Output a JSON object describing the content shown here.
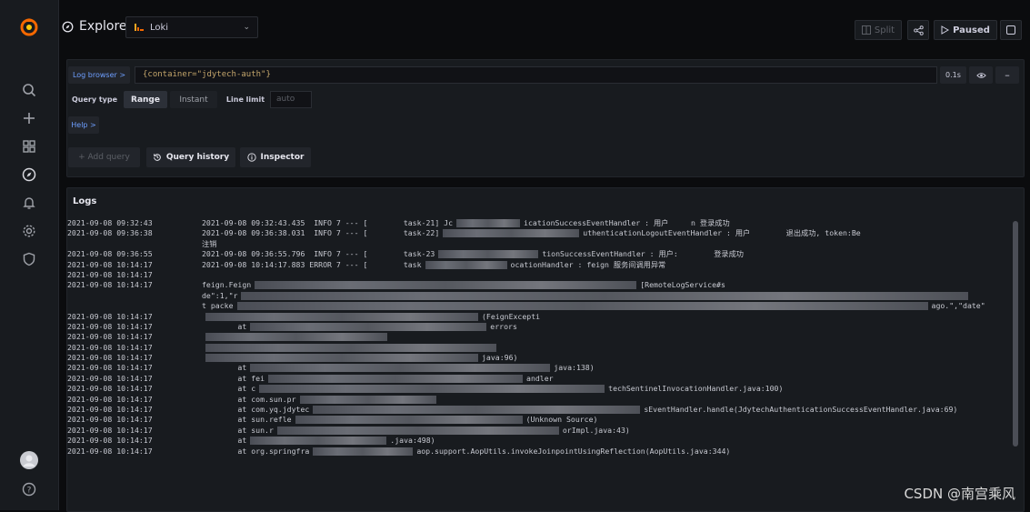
{
  "header": {
    "title": "Explore",
    "datasource": "Loki",
    "split_label": "Split",
    "paused_label": "Paused"
  },
  "query": {
    "log_browser_label": "Log browser >",
    "expression": "{container=\"jdytech-auth\"}",
    "duration_badge": "0.1s",
    "query_type_label": "Query type",
    "range_label": "Range",
    "instant_label": "Instant",
    "line_limit_label": "Line limit",
    "line_limit_placeholder": "auto",
    "help_label": "Help >",
    "add_query_label": "+ Add query",
    "query_history_label": "Query history",
    "inspector_label": "Inspector"
  },
  "logs": {
    "title": "Logs",
    "lines": [
      {
        "ts": "2021-09-08 09:32:43",
        "text": "2021-09-08 09:32:43.435  INFO 7 --- [        task-21] Jc",
        "tail": "icationSuccessEventHandler : 用户     n 登录成功"
      },
      {
        "ts": "2021-09-08 09:36:38",
        "text": "2021-09-08 09:36:38.031  INFO 7 --- [        task-22]",
        "tail": "uthenticationLogoutEventHandler : 用户        退出成功, token:Be"
      },
      {
        "ts": "",
        "text": "注销",
        "tail": ""
      },
      {
        "ts": "2021-09-08 09:36:55",
        "text": "2021-09-08 09:36:55.796  INFO 7 --- [        task-23",
        "tail": "tionSuccessEventHandler : 用户:        登录成功"
      },
      {
        "ts": "2021-09-08 10:14:17",
        "text": "2021-09-08 10:14:17.883 ERROR 7 --- [        task",
        "tail": "ocationHandler : feign 服务间调用异常"
      },
      {
        "ts": "2021-09-08 10:14:17",
        "text": "",
        "tail": ""
      },
      {
        "ts": "2021-09-08 10:14:17",
        "text": "feign.Feign",
        "tail": "[RemoteLogService#s"
      },
      {
        "ts": "",
        "text": "de\":1,\"r",
        "tail": ""
      },
      {
        "ts": "",
        "text": "t packe",
        "tail": "ago.\",\"date\""
      },
      {
        "ts": "2021-09-08 10:14:17",
        "text": "",
        "tail": "(FeignExcepti"
      },
      {
        "ts": "2021-09-08 10:14:17",
        "text": "        at",
        "tail": "errors"
      },
      {
        "ts": "2021-09-08 10:14:17",
        "text": "",
        "tail": ""
      },
      {
        "ts": "2021-09-08 10:14:17",
        "text": "",
        "tail": ""
      },
      {
        "ts": "2021-09-08 10:14:17",
        "text": "",
        "tail": "java:96)"
      },
      {
        "ts": "2021-09-08 10:14:17",
        "text": "        at",
        "tail": "java:138)"
      },
      {
        "ts": "2021-09-08 10:14:17",
        "text": "        at fei",
        "tail": "andler"
      },
      {
        "ts": "2021-09-08 10:14:17",
        "text": "        at c",
        "tail": "techSentinelInvocationHandler.java:100)"
      },
      {
        "ts": "2021-09-08 10:14:17",
        "text": "        at com.sun.pr",
        "tail": ""
      },
      {
        "ts": "2021-09-08 10:14:17",
        "text": "        at com.yq.jdytec",
        "tail": "sEventHandler.handle(JdytechAuthenticationSuccessEventHandler.java:69)"
      },
      {
        "ts": "2021-09-08 10:14:17",
        "text": "        at sun.refle",
        "tail": "(Unknown Source)"
      },
      {
        "ts": "2021-09-08 10:14:17",
        "text": "        at sun.r",
        "tail": "orImpl.java:43)"
      },
      {
        "ts": "2021-09-08 10:14:17",
        "text": "        at",
        "tail": ".java:498)"
      },
      {
        "ts": "2021-09-08 10:14:17",
        "text": "        at org.springfra",
        "tail": "aop.support.AopUtils.invokeJoinpointUsingReflection(AopUtils.java:344)"
      }
    ]
  },
  "watermark": "CSDN @南宫乘风",
  "colors": {
    "accent_orange": "#f46800",
    "background": "#0b0c0e",
    "panel": "#181b1f",
    "range_selected": "#2c3038",
    "code_color": "#c3a56b"
  },
  "icons": {
    "logo": "grafana-logo-icon",
    "explore": "compass-icon",
    "search": "search-icon",
    "create": "plus-icon",
    "dashboards": "grid-icon",
    "alerting": "bell-icon",
    "config": "gear-icon",
    "shield": "shield-icon",
    "user": "avatar",
    "help": "help-icon"
  }
}
